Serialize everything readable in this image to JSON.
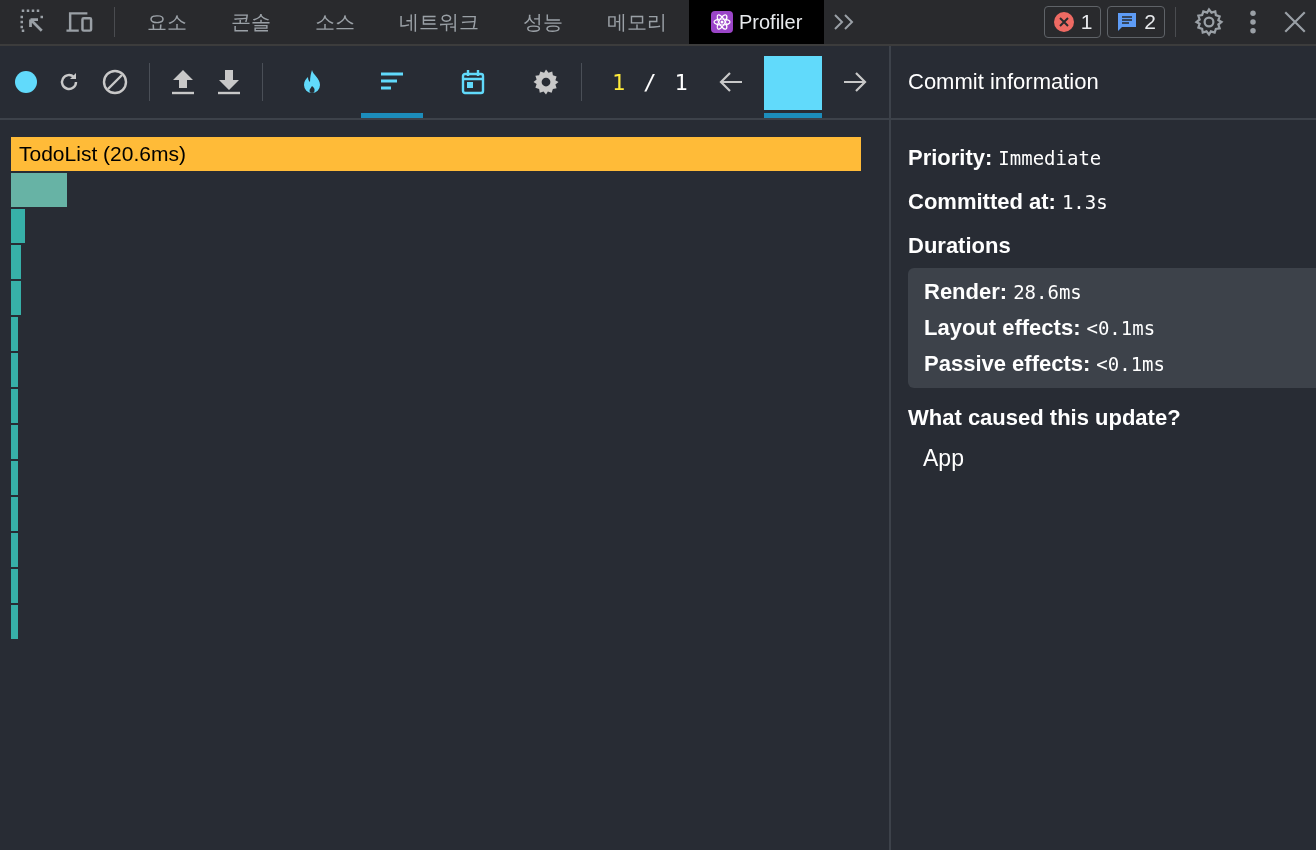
{
  "devtools_tabs": [
    {
      "label": "요소",
      "selected": false,
      "kind": "plain"
    },
    {
      "label": "콘솔",
      "selected": false,
      "kind": "plain"
    },
    {
      "label": "소스",
      "selected": false,
      "kind": "plain"
    },
    {
      "label": "네트워크",
      "selected": false,
      "kind": "plain"
    },
    {
      "label": "성능",
      "selected": false,
      "kind": "plain"
    },
    {
      "label": "메모리",
      "selected": false,
      "kind": "plain"
    },
    {
      "label": "Profiler",
      "selected": true,
      "kind": "react"
    }
  ],
  "badges": [
    {
      "kind": "error",
      "count": "1"
    },
    {
      "kind": "message",
      "count": "2"
    }
  ],
  "profiler_toolbar": {
    "views": [
      {
        "kind": "flame",
        "selected": false
      },
      {
        "kind": "ranked",
        "selected": true
      },
      {
        "kind": "timeline",
        "selected": false
      }
    ],
    "commit_index": "1",
    "separator": "/",
    "commit_total": "1"
  },
  "ranked_chart": {
    "top_label": "TodoList (20.6ms)"
  },
  "commit_info": {
    "title": "Commit information",
    "priority_label": "Priority:",
    "priority": "Immediate",
    "committed_label": "Committed at:",
    "committed": "1.3s",
    "durations_title": "Durations",
    "durations": [
      {
        "label": "Render:",
        "value": "28.6ms"
      },
      {
        "label": "Layout effects:",
        "value": "<0.1ms"
      },
      {
        "label": "Passive effects:",
        "value": "<0.1ms"
      }
    ],
    "cause_title": "What caused this update?",
    "causes": [
      "App"
    ]
  }
}
